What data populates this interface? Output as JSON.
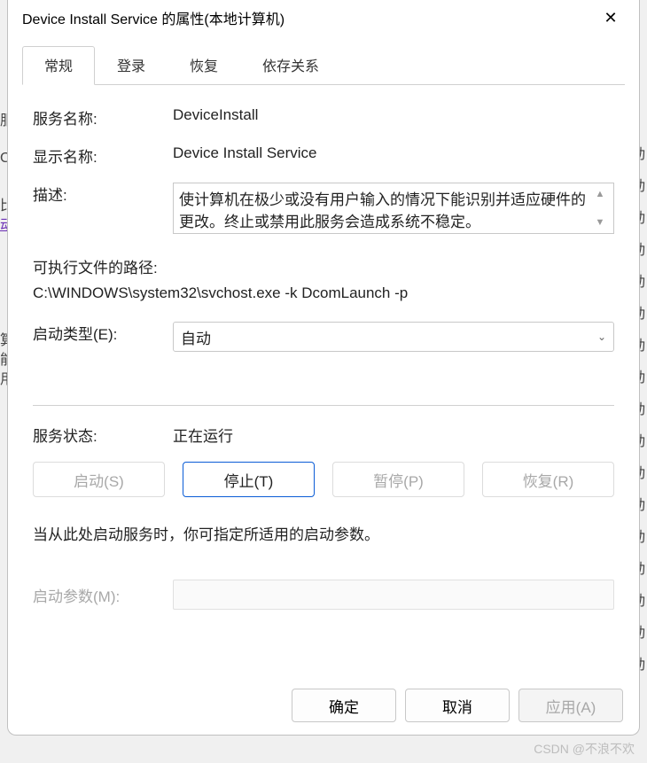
{
  "window": {
    "title": "Device Install Service 的属性(本地计算机)"
  },
  "tabs": {
    "general": "常规",
    "logon": "登录",
    "recovery": "恢复",
    "dependencies": "依存关系"
  },
  "labels": {
    "service_name": "服务名称:",
    "display_name": "显示名称:",
    "description": "描述:",
    "exe_path_label": "可执行文件的路径:",
    "startup_type": "启动类型(E):",
    "service_status": "服务状态:",
    "start_hint": "当从此处启动服务时，你可指定所适用的启动参数。",
    "start_params": "启动参数(M):"
  },
  "values": {
    "service_name": "DeviceInstall",
    "display_name": "Device Install Service",
    "description": "使计算机在极少或没有用户输入的情况下能识别并适应硬件的更改。终止或禁用此服务会造成系统不稳定。",
    "exe_path": "C:\\WINDOWS\\system32\\svchost.exe -k DcomLaunch -p",
    "startup_type_selected": "自动",
    "service_status": "正在运行",
    "start_params": ""
  },
  "buttons": {
    "start": "启动(S)",
    "stop": "停止(T)",
    "pause": "暂停(P)",
    "resume": "恢复(R)",
    "ok": "确定",
    "cancel": "取消",
    "apply": "应用(A)"
  },
  "bg": {
    "s1": "服",
    "s2": "Co",
    "s3": "比",
    "s4": "动",
    "s5": "算",
    "s6": "能",
    "s7": "用",
    "char_dong": "动"
  },
  "watermark": "CSDN @不浪不欢"
}
